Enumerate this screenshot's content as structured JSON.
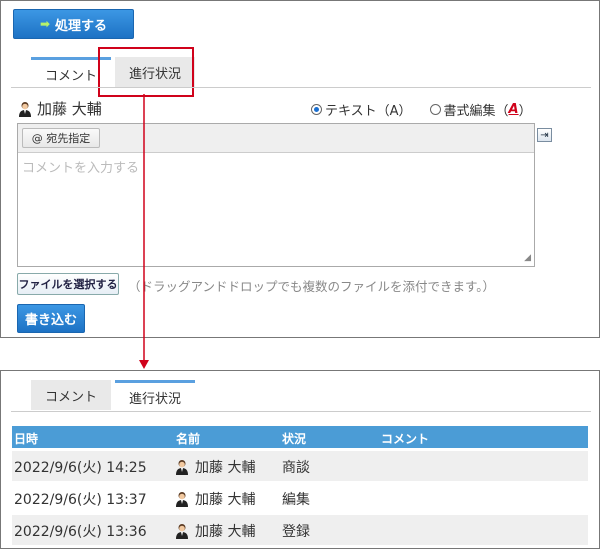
{
  "top": {
    "process_button": "処理する",
    "tabs": [
      "コメント",
      "進行状況"
    ],
    "user_name": "加藤 大輔",
    "radio_text": "テキスト（A）",
    "radio_rich": "書式編集（",
    "radio_rich_icon": "A",
    "radio_rich_close": "）",
    "mention_button": "@ 宛先指定",
    "comment_placeholder": "コメントを入力する",
    "file_button": "ファイルを選択する",
    "file_hint": "（ドラッグアンドドロップでも複数のファイルを添付できます。）",
    "submit_button": "書き込む"
  },
  "bottom": {
    "tabs": [
      "コメント",
      "進行状況"
    ],
    "columns": [
      "日時",
      "名前",
      "状況",
      "コメント"
    ],
    "rows": [
      {
        "datetime": "2022/9/6(火) 14:25",
        "name": "加藤 大輔",
        "status": "商談"
      },
      {
        "datetime": "2022/9/6(火) 13:37",
        "name": "加藤 大輔",
        "status": "編集"
      },
      {
        "datetime": "2022/9/6(火) 13:36",
        "name": "加藤 大輔",
        "status": "登録"
      }
    ]
  },
  "colors": {
    "accent": "#1d72c4",
    "highlight": "#d0021b",
    "header": "#4b9cd6"
  }
}
